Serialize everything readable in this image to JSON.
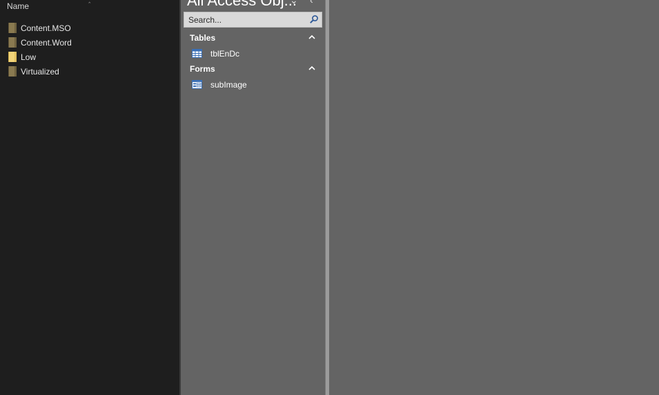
{
  "explorer": {
    "column_header": "Name",
    "items": [
      {
        "label": "Content.MSO",
        "icon": "folder-icon"
      },
      {
        "label": "Content.Word",
        "icon": "folder-icon"
      },
      {
        "label": "Low",
        "icon": "folder-open-icon"
      },
      {
        "label": "Virtualized",
        "icon": "folder-icon"
      }
    ]
  },
  "nav_pane": {
    "title": "All Access Obj...",
    "search": {
      "placeholder": "Search...",
      "value": ""
    },
    "groups": [
      {
        "label": "Tables",
        "items": [
          {
            "label": "tblEnDc",
            "icon": "table-icon"
          }
        ]
      },
      {
        "label": "Forms",
        "items": [
          {
            "label": "subImage",
            "icon": "form-icon"
          }
        ]
      }
    ]
  },
  "colors": {
    "explorer_bg": "#1e1e1e",
    "nav_bg": "#646464",
    "workspace_bg": "#646464",
    "splitter": "#9b9b9b"
  }
}
